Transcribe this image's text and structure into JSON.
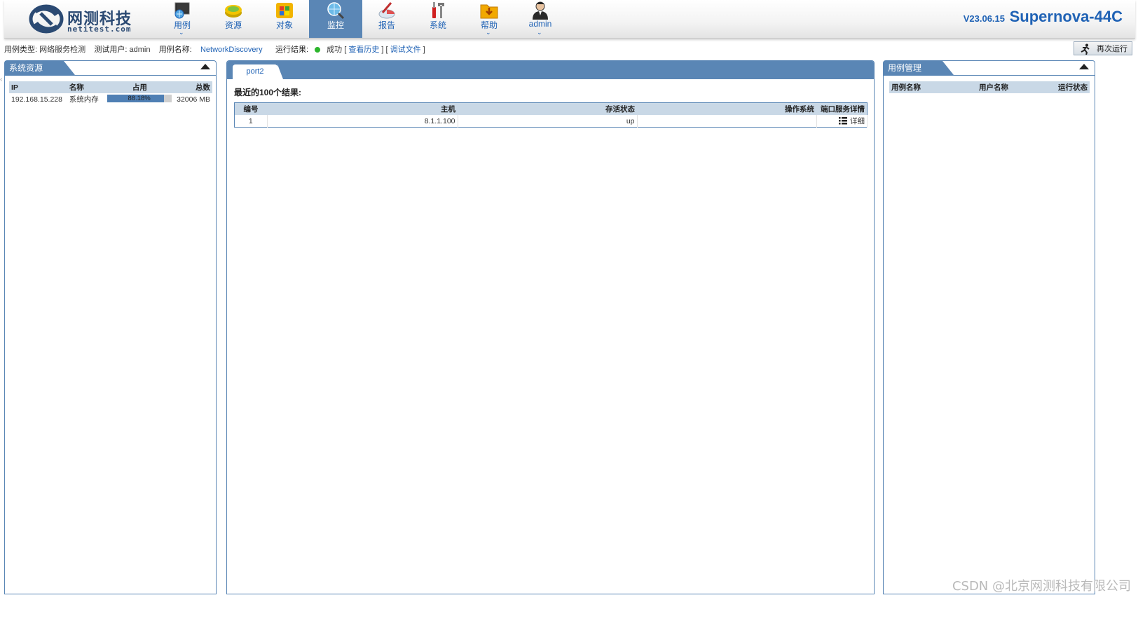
{
  "logo": {
    "cn": "网测科技",
    "en": "netitest.com"
  },
  "nav": [
    {
      "label": "用例",
      "icon": "monitor-globe-icon",
      "has_menu": true,
      "active": false
    },
    {
      "label": "资源",
      "icon": "disk-stack-icon",
      "has_menu": false,
      "active": false
    },
    {
      "label": "对象",
      "icon": "windows-blocks-icon",
      "has_menu": false,
      "active": false
    },
    {
      "label": "监控",
      "icon": "globe-magnifier-icon",
      "has_menu": false,
      "active": true
    },
    {
      "label": "报告",
      "icon": "chart-pen-icon",
      "has_menu": false,
      "active": false
    },
    {
      "label": "系统",
      "icon": "tools-icon",
      "has_menu": false,
      "active": false
    },
    {
      "label": "帮助",
      "icon": "folder-download-icon",
      "has_menu": true,
      "active": false
    },
    {
      "label": "admin",
      "icon": "user-icon",
      "has_menu": true,
      "active": false
    }
  ],
  "version": "V23.06.15",
  "product": "Supernova-44C",
  "info": {
    "type_label": "用例类型:",
    "type_value": "网络服务检测",
    "user_label": "测试用户:",
    "user_value": "admin",
    "name_label": "用例名称:",
    "name_value": "NetworkDiscovery",
    "result_label": "运行结果:",
    "result_value": "成功",
    "history_link": "查看历史",
    "debug_link": "调试文件",
    "rerun_label": "再次运行"
  },
  "left_panel": {
    "title": "系统资源",
    "columns": [
      "IP",
      "名称",
      "占用",
      "总数"
    ],
    "rows": [
      {
        "ip": "192.168.15.228",
        "name": "系统内存",
        "usage_text": "88.18%",
        "usage": 0.8818,
        "total": "32006 MB"
      }
    ]
  },
  "center_panel": {
    "tab": "port2",
    "title": "最近的100个结果:",
    "columns": [
      "编号",
      "主机",
      "存活状态",
      "操作系统",
      "端口服务详情"
    ],
    "rows": [
      {
        "num": "1",
        "host": "8.1.1.100",
        "status": "up",
        "os": "",
        "detail": "详细"
      }
    ]
  },
  "right_panel": {
    "title": "用例管理",
    "columns": [
      "用例名称",
      "用户名称",
      "运行状态"
    ]
  },
  "watermark": "CSDN @北京网测科技有限公司",
  "colors": {
    "accent": "#5a86b5",
    "link": "#1f62b5",
    "success": "#2cb52c",
    "header_bg": "#c9d8e6"
  }
}
